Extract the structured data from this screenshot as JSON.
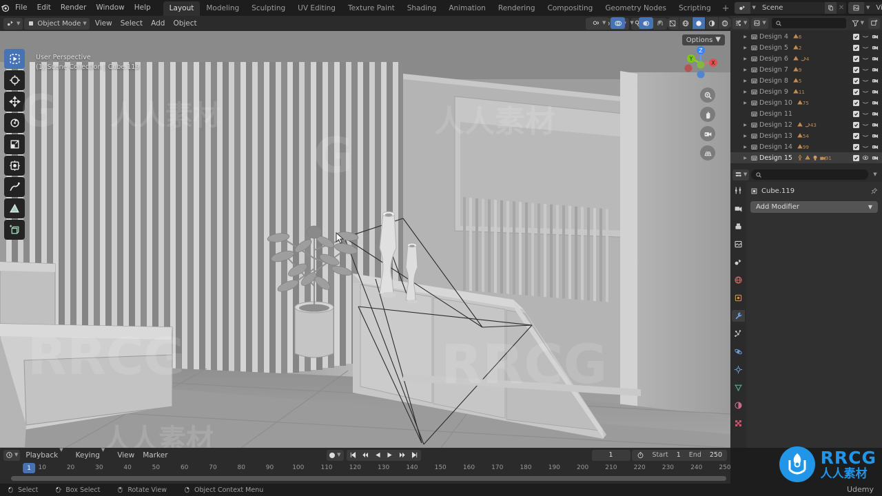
{
  "app": {
    "logo_icon": "blender-logo-icon",
    "menus": [
      "File",
      "Edit",
      "Render",
      "Window",
      "Help"
    ],
    "workspace_tabs": [
      {
        "label": "Layout",
        "active": true
      },
      {
        "label": "Modeling",
        "active": false
      },
      {
        "label": "Sculpting",
        "active": false
      },
      {
        "label": "UV Editing",
        "active": false
      },
      {
        "label": "Texture Paint",
        "active": false
      },
      {
        "label": "Shading",
        "active": false
      },
      {
        "label": "Animation",
        "active": false
      },
      {
        "label": "Rendering",
        "active": false
      },
      {
        "label": "Compositing",
        "active": false
      },
      {
        "label": "Geometry Nodes",
        "active": false
      },
      {
        "label": "Scripting",
        "active": false
      }
    ],
    "add_workspace_label": "+",
    "scene": {
      "icon": "scene-icon",
      "name": "Scene",
      "new_icon": "new-copy-icon",
      "close_icon": "x-icon"
    },
    "view_layer": {
      "icon": "viewlayer-icon",
      "name": "ViewLayer",
      "new_icon": "new-copy-icon",
      "close_icon": "x-icon"
    }
  },
  "viewport_header": {
    "editor_type_icon": "editor-type-3dview-icon",
    "mode": "Object Mode",
    "menus": [
      "View",
      "Select",
      "Add",
      "Object"
    ],
    "transform_orientation": "Global",
    "snap_icon": "magnet-icon",
    "proportional_icon": "proportional-edit-icon",
    "pivot_icon": "pivot-point-icon",
    "overlay_icon": "overlays-icon",
    "xray_icon": "xray-icon",
    "shading_modes": [
      {
        "icon": "wireframe-icon",
        "active": false
      },
      {
        "icon": "solid-icon",
        "active": false
      },
      {
        "icon": "material-preview-icon",
        "active": true
      },
      {
        "icon": "rendered-icon",
        "active": false
      },
      {
        "icon": "shading-dropdown-icon",
        "active": false
      }
    ],
    "gizmo_icon": "gizmo-icon",
    "visibility_icon": "object-visibility-icon",
    "options_label": "Options"
  },
  "viewport": {
    "overlay_line1": "User Perspective",
    "overlay_line2": "(1) Scene Collection | Cube.119",
    "tools": [
      {
        "name": "tweak-select-tool",
        "active": true
      },
      {
        "name": "cursor-tool",
        "active": false
      },
      {
        "name": "move-tool",
        "active": false
      },
      {
        "name": "rotate-tool",
        "active": false
      },
      {
        "name": "scale-tool",
        "active": false
      },
      {
        "name": "transform-tool",
        "active": false
      },
      {
        "name": "annotate-tool",
        "active": false
      },
      {
        "name": "measure-tool",
        "active": false
      },
      {
        "name": "add-cube-tool",
        "active": false
      }
    ],
    "gizmo_axes": [
      {
        "label": "Z",
        "color": "#3b83f0"
      },
      {
        "label": "Y",
        "color": "#7dc71b"
      },
      {
        "label": "X",
        "color": "#e05252"
      }
    ],
    "nav_buttons": [
      {
        "name": "zoom-icon"
      },
      {
        "name": "pan-hand-icon"
      },
      {
        "name": "camera-view-icon"
      },
      {
        "name": "toggle-perspective-icon"
      }
    ],
    "cursor_icon": "mouse-pointer-icon"
  },
  "outliner": {
    "display_mode_icon": "outliner-display-mode-icon",
    "filter_id_icon": "outliner-id-type-icon",
    "search_placeholder": "",
    "filter_icon": "filter-funnel-icon",
    "new_collection_icon": "new-collection-icon",
    "items": [
      {
        "label": "Design 4",
        "expandable": true,
        "count": "6",
        "selected": false,
        "extra_icons": [
          "mesh-data-icon"
        ]
      },
      {
        "label": "Design 5",
        "expandable": true,
        "count": "2",
        "selected": false,
        "extra_icons": [
          "mesh-data-icon"
        ]
      },
      {
        "label": "Design 6",
        "expandable": true,
        "count": "4",
        "selected": false,
        "extra_icons": [
          "mesh-data-icon",
          "modifier-icon"
        ]
      },
      {
        "label": "Design 7",
        "expandable": true,
        "count": "9",
        "selected": false,
        "extra_icons": [
          "mesh-data-icon"
        ]
      },
      {
        "label": "Design 8",
        "expandable": true,
        "count": "5",
        "selected": false,
        "extra_icons": [
          "mesh-data-icon"
        ]
      },
      {
        "label": "Design 9",
        "expandable": true,
        "count": "11",
        "selected": false,
        "extra_icons": [
          "mesh-data-icon"
        ]
      },
      {
        "label": "Design 10",
        "expandable": true,
        "count": "75",
        "selected": false,
        "extra_icons": [
          "mesh-data-icon"
        ]
      },
      {
        "label": "Design 11",
        "expandable": false,
        "count": "",
        "selected": false,
        "extra_icons": []
      },
      {
        "label": "Design 12",
        "expandable": true,
        "count": "43",
        "selected": false,
        "extra_icons": [
          "mesh-data-icon",
          "modifier-icon"
        ]
      },
      {
        "label": "Design 13",
        "expandable": true,
        "count": "54",
        "selected": false,
        "extra_icons": [
          "mesh-data-icon"
        ]
      },
      {
        "label": "Design 14",
        "expandable": true,
        "count": "99",
        "selected": false,
        "extra_icons": [
          "mesh-data-icon"
        ]
      },
      {
        "label": "Design 15",
        "expandable": true,
        "count": "91",
        "selected": true,
        "extra_icons": [
          "armature-icon",
          "mesh-data-icon",
          "light-icon",
          "camera-icon"
        ]
      }
    ]
  },
  "properties": {
    "editor_icon": "properties-editor-icon",
    "search_placeholder": "",
    "tabs": [
      {
        "name": "tool-tab",
        "active": false
      },
      {
        "name": "render-tab",
        "active": false
      },
      {
        "name": "output-tab",
        "active": false
      },
      {
        "name": "view-layer-tab",
        "active": false
      },
      {
        "name": "scene-tab",
        "active": false
      },
      {
        "name": "world-tab",
        "active": false
      },
      {
        "name": "object-tab",
        "active": false
      },
      {
        "name": "modifier-tab",
        "active": true
      },
      {
        "name": "particles-tab",
        "active": false
      },
      {
        "name": "physics-tab",
        "active": false
      },
      {
        "name": "constraints-tab",
        "active": false
      },
      {
        "name": "object-data-tab",
        "active": false
      },
      {
        "name": "material-tab",
        "active": false
      },
      {
        "name": "texture-tab",
        "active": false
      }
    ],
    "breadcrumb_icon": "object-icon",
    "breadcrumb_name": "Cube.119",
    "pin_icon": "pin-icon",
    "add_modifier_label": "Add Modifier",
    "add_modifier_caret": "dropdown-caret-icon"
  },
  "timeline": {
    "editor_icon": "timeline-editor-icon",
    "menus": [
      "Playback",
      "Keying",
      "View",
      "Marker"
    ],
    "record_icon": "auto-keying-record-icon",
    "transport": [
      {
        "name": "jump-to-start-icon"
      },
      {
        "name": "jump-to-keyframe-prev-icon"
      },
      {
        "name": "play-reverse-icon"
      },
      {
        "name": "play-icon"
      },
      {
        "name": "jump-to-keyframe-next-icon"
      },
      {
        "name": "jump-to-end-icon"
      }
    ],
    "current_frame": "1",
    "stopwatch_icon": "use-preview-range-icon",
    "start_label": "Start",
    "start_value": "1",
    "end_label": "End",
    "end_value": "250",
    "ticks": [
      10,
      20,
      30,
      40,
      50,
      60,
      70,
      80,
      90,
      100,
      110,
      120,
      130,
      140,
      150,
      160,
      170,
      180,
      190,
      200,
      210,
      220,
      230,
      240,
      250
    ],
    "playhead_label": "1"
  },
  "status_bar": {
    "items": [
      {
        "icon": "mouse-left-icon",
        "label": "Select"
      },
      {
        "icon": "mouse-left-drag-icon",
        "label": "Box Select"
      },
      {
        "icon": "mouse-middle-icon",
        "label": "Rotate View"
      },
      {
        "icon": "mouse-right-icon",
        "label": "Object Context Menu"
      }
    ]
  },
  "watermarks": {
    "brand": "RRCG",
    "brand_cn": "人人素材",
    "course_platform": "Udemy",
    "scatter_cn": "人人素材"
  },
  "colors": {
    "accent_blue": "#4772b3",
    "logo_blue": "#2196e8",
    "header_bg": "#2b2b2b",
    "panel_bg": "#303030",
    "topbar_bg": "#1d1d1d",
    "badge_orange": "#c58b50"
  }
}
